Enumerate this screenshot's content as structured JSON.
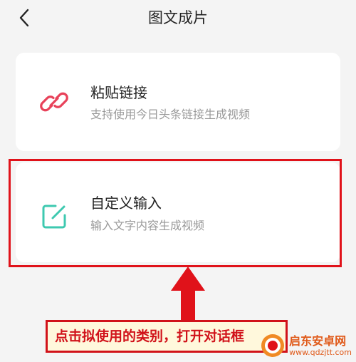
{
  "header": {
    "title": "图文成片",
    "back_icon": "chevron-left-icon"
  },
  "cards": [
    {
      "title": "粘贴链接",
      "subtitle": "支持使用今日头条链接生成视频",
      "icon": "link-icon",
      "icon_color": "#e8425a"
    },
    {
      "title": "自定义输入",
      "subtitle": "输入文字内容生成视频",
      "icon": "edit-square-icon",
      "icon_color": "#3ec9b0"
    }
  ],
  "annotation": {
    "text": "点击拟使用的类别，打开对话框",
    "color": "#e0121a",
    "arrow_icon": "arrow-up-icon"
  },
  "watermark": {
    "name": "启东安卓网",
    "url": "www.qdzjtt.com"
  },
  "colors": {
    "background": "#f4f4f4",
    "card": "#ffffff"
  }
}
